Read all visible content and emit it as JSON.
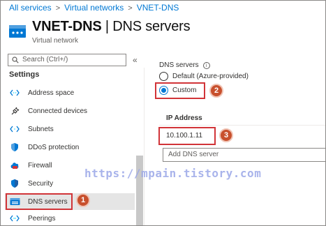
{
  "breadcrumb": [
    "All services",
    "Virtual networks",
    "VNET-DNS"
  ],
  "header": {
    "resource": "VNET-DNS",
    "separator": " | ",
    "page": "DNS servers",
    "subtitle": "Virtual network"
  },
  "sidebar": {
    "search_placeholder": "Search (Ctrl+/)",
    "collapse": "«",
    "section": "Settings",
    "items": [
      {
        "label": "Address space",
        "icon": "address-space-icon"
      },
      {
        "label": "Connected devices",
        "icon": "plug-icon"
      },
      {
        "label": "Subnets",
        "icon": "subnets-icon"
      },
      {
        "label": "DDoS protection",
        "icon": "shield-icon"
      },
      {
        "label": "Firewall",
        "icon": "firewall-icon"
      },
      {
        "label": "Security",
        "icon": "security-shield-icon"
      },
      {
        "label": "DNS servers",
        "icon": "dns-server-icon"
      },
      {
        "label": "Peerings",
        "icon": "peerings-icon"
      }
    ],
    "active_index": 6
  },
  "main": {
    "dns_label": "DNS servers",
    "info_glyph": "i",
    "options": [
      {
        "label": "Default (Azure-provided)",
        "selected": false
      },
      {
        "label": "Custom",
        "selected": true
      }
    ],
    "ip_header": "IP Address",
    "ip_value": "10.100.1.11",
    "add_placeholder": "Add DNS server"
  },
  "callouts": [
    "1",
    "2",
    "3"
  ],
  "watermark": "https://mpain.tistory.com",
  "colors": {
    "accent": "#0078d4",
    "highlight": "#d13438",
    "badge": "#c8502d"
  }
}
